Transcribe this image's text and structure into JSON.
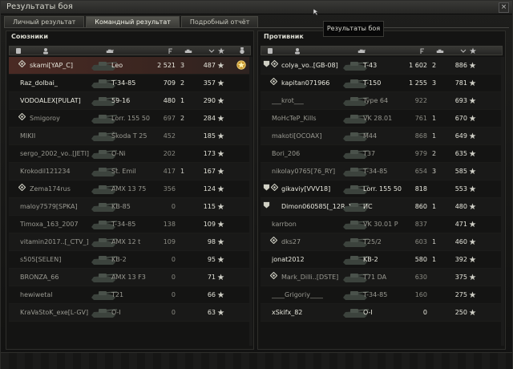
{
  "window": {
    "title": "Результаты боя",
    "close_glyph": "×"
  },
  "tabs": [
    {
      "label": "Личный результат",
      "active": false
    },
    {
      "label": "Командный результат",
      "active": true
    },
    {
      "label": "Подробный отчёт",
      "active": false
    }
  ],
  "tooltip": "Результаты боя",
  "allies": {
    "title": "Союзники",
    "rows": [
      {
        "player": "skami[YAP_C]",
        "tank": "Leo",
        "damage": "2 521",
        "kills": "3",
        "xp": "487",
        "alive": true,
        "squad": true,
        "you": true,
        "medal": true
      },
      {
        "player": "Raz_dolbai_",
        "tank": "T-34-85",
        "damage": "709",
        "kills": "2",
        "xp": "357",
        "alive": true
      },
      {
        "player": "VODOALEX[PULAT]",
        "tank": "59-16",
        "damage": "480",
        "kills": "1",
        "xp": "290",
        "alive": true
      },
      {
        "player": "Smigoroy",
        "tank": "Lorr. 155 50",
        "damage": "697",
        "kills": "2",
        "xp": "284",
        "alive": false,
        "squad": true
      },
      {
        "player": "MIKII",
        "tank": "Škoda T 25",
        "damage": "452",
        "kills": "",
        "xp": "185",
        "alive": false
      },
      {
        "player": "sergo_2002_vo..[JETI]",
        "tank": "O-Ni",
        "damage": "202",
        "kills": "",
        "xp": "173",
        "alive": false
      },
      {
        "player": "Krokodil121234",
        "tank": "St. Emil",
        "damage": "417",
        "kills": "1",
        "xp": "167",
        "alive": false
      },
      {
        "player": "Zema174rus",
        "tank": "AMX 13 75",
        "damage": "356",
        "kills": "",
        "xp": "124",
        "alive": false,
        "squad": true
      },
      {
        "player": "maloy7579[SPKA]",
        "tank": "KB-85",
        "damage": "0",
        "kills": "",
        "xp": "115",
        "alive": false
      },
      {
        "player": "Timoxa_163_2007",
        "tank": "T-34-85",
        "damage": "138",
        "kills": "",
        "xp": "109",
        "alive": false
      },
      {
        "player": "vitamin2017..[_CTV_]",
        "tank": "AMX 12 t",
        "damage": "109",
        "kills": "",
        "xp": "98",
        "alive": false
      },
      {
        "player": "s505[SELEN]",
        "tank": "KB-2",
        "damage": "0",
        "kills": "",
        "xp": "95",
        "alive": false
      },
      {
        "player": "BRONZA_66",
        "tank": "AMX 13 F3",
        "damage": "0",
        "kills": "",
        "xp": "71",
        "alive": false
      },
      {
        "player": "hewiwetal",
        "tank": "T21",
        "damage": "0",
        "kills": "",
        "xp": "66",
        "alive": false
      },
      {
        "player": "KraVaStoK_exe[L-GV]",
        "tank": "O-I",
        "damage": "0",
        "kills": "",
        "xp": "63",
        "alive": false
      }
    ]
  },
  "enemies": {
    "title": "Противник",
    "rows": [
      {
        "player": "colya_vo..[GB-08]",
        "tank": "T-43",
        "damage": "1 602",
        "kills": "2",
        "xp": "886",
        "alive": true,
        "squad": true,
        "platoon": true
      },
      {
        "player": "kapitan071966",
        "tank": "T-150",
        "damage": "1 255",
        "kills": "3",
        "xp": "781",
        "alive": true,
        "squad": true
      },
      {
        "player": "___krot___",
        "tank": "Type 64",
        "damage": "922",
        "kills": "",
        "xp": "693",
        "alive": false
      },
      {
        "player": "MoHcTeP_Kills",
        "tank": "VK 28.01",
        "damage": "761",
        "kills": "1",
        "xp": "670",
        "alive": false
      },
      {
        "player": "makoti[OCOAX]",
        "tank": "M44",
        "damage": "868",
        "kills": "1",
        "xp": "649",
        "alive": false
      },
      {
        "player": "Bori_206",
        "tank": "T37",
        "damage": "979",
        "kills": "2",
        "xp": "635",
        "alive": false
      },
      {
        "player": "nikolay0765[76_RY]",
        "tank": "T-34-85",
        "damage": "654",
        "kills": "3",
        "xp": "585",
        "alive": false
      },
      {
        "player": "gikaviy[VVV18]",
        "tank": "Lorr. 155 50",
        "damage": "818",
        "kills": "",
        "xp": "553",
        "alive": true,
        "squad": true,
        "platoon": true
      },
      {
        "player": "Dimon060585[_12R_]",
        "tank": "ИС",
        "damage": "860",
        "kills": "1",
        "xp": "480",
        "alive": true,
        "platoon": true
      },
      {
        "player": "karrbon",
        "tank": "VK 30.01 P",
        "damage": "837",
        "kills": "",
        "xp": "471",
        "alive": false
      },
      {
        "player": "dks27",
        "tank": "T25/2",
        "damage": "603",
        "kills": "1",
        "xp": "460",
        "alive": false,
        "squad": true
      },
      {
        "player": "jonat2012",
        "tank": "KB-2",
        "damage": "580",
        "kills": "1",
        "xp": "392",
        "alive": true
      },
      {
        "player": "Mark_Dilli..[DSTE]",
        "tank": "T71 DA",
        "damage": "630",
        "kills": "",
        "xp": "375",
        "alive": false,
        "squad": true
      },
      {
        "player": "____Grigoriy____",
        "tank": "T-34-85",
        "damage": "160",
        "kills": "",
        "xp": "275",
        "alive": false
      },
      {
        "player": "xSkifx_82",
        "tank": "O-I",
        "damage": "0",
        "kills": "",
        "xp": "250",
        "alive": true
      }
    ]
  },
  "colors": {
    "highlight_row": "#4a2a24",
    "text_alive": "#e8e8de",
    "text_dead": "#9a9a92"
  },
  "icons": {
    "squad": "squad-diamond-icon",
    "star": "star-icon",
    "medal": "medal-icon",
    "platoon": "platoon-shield-icon"
  }
}
